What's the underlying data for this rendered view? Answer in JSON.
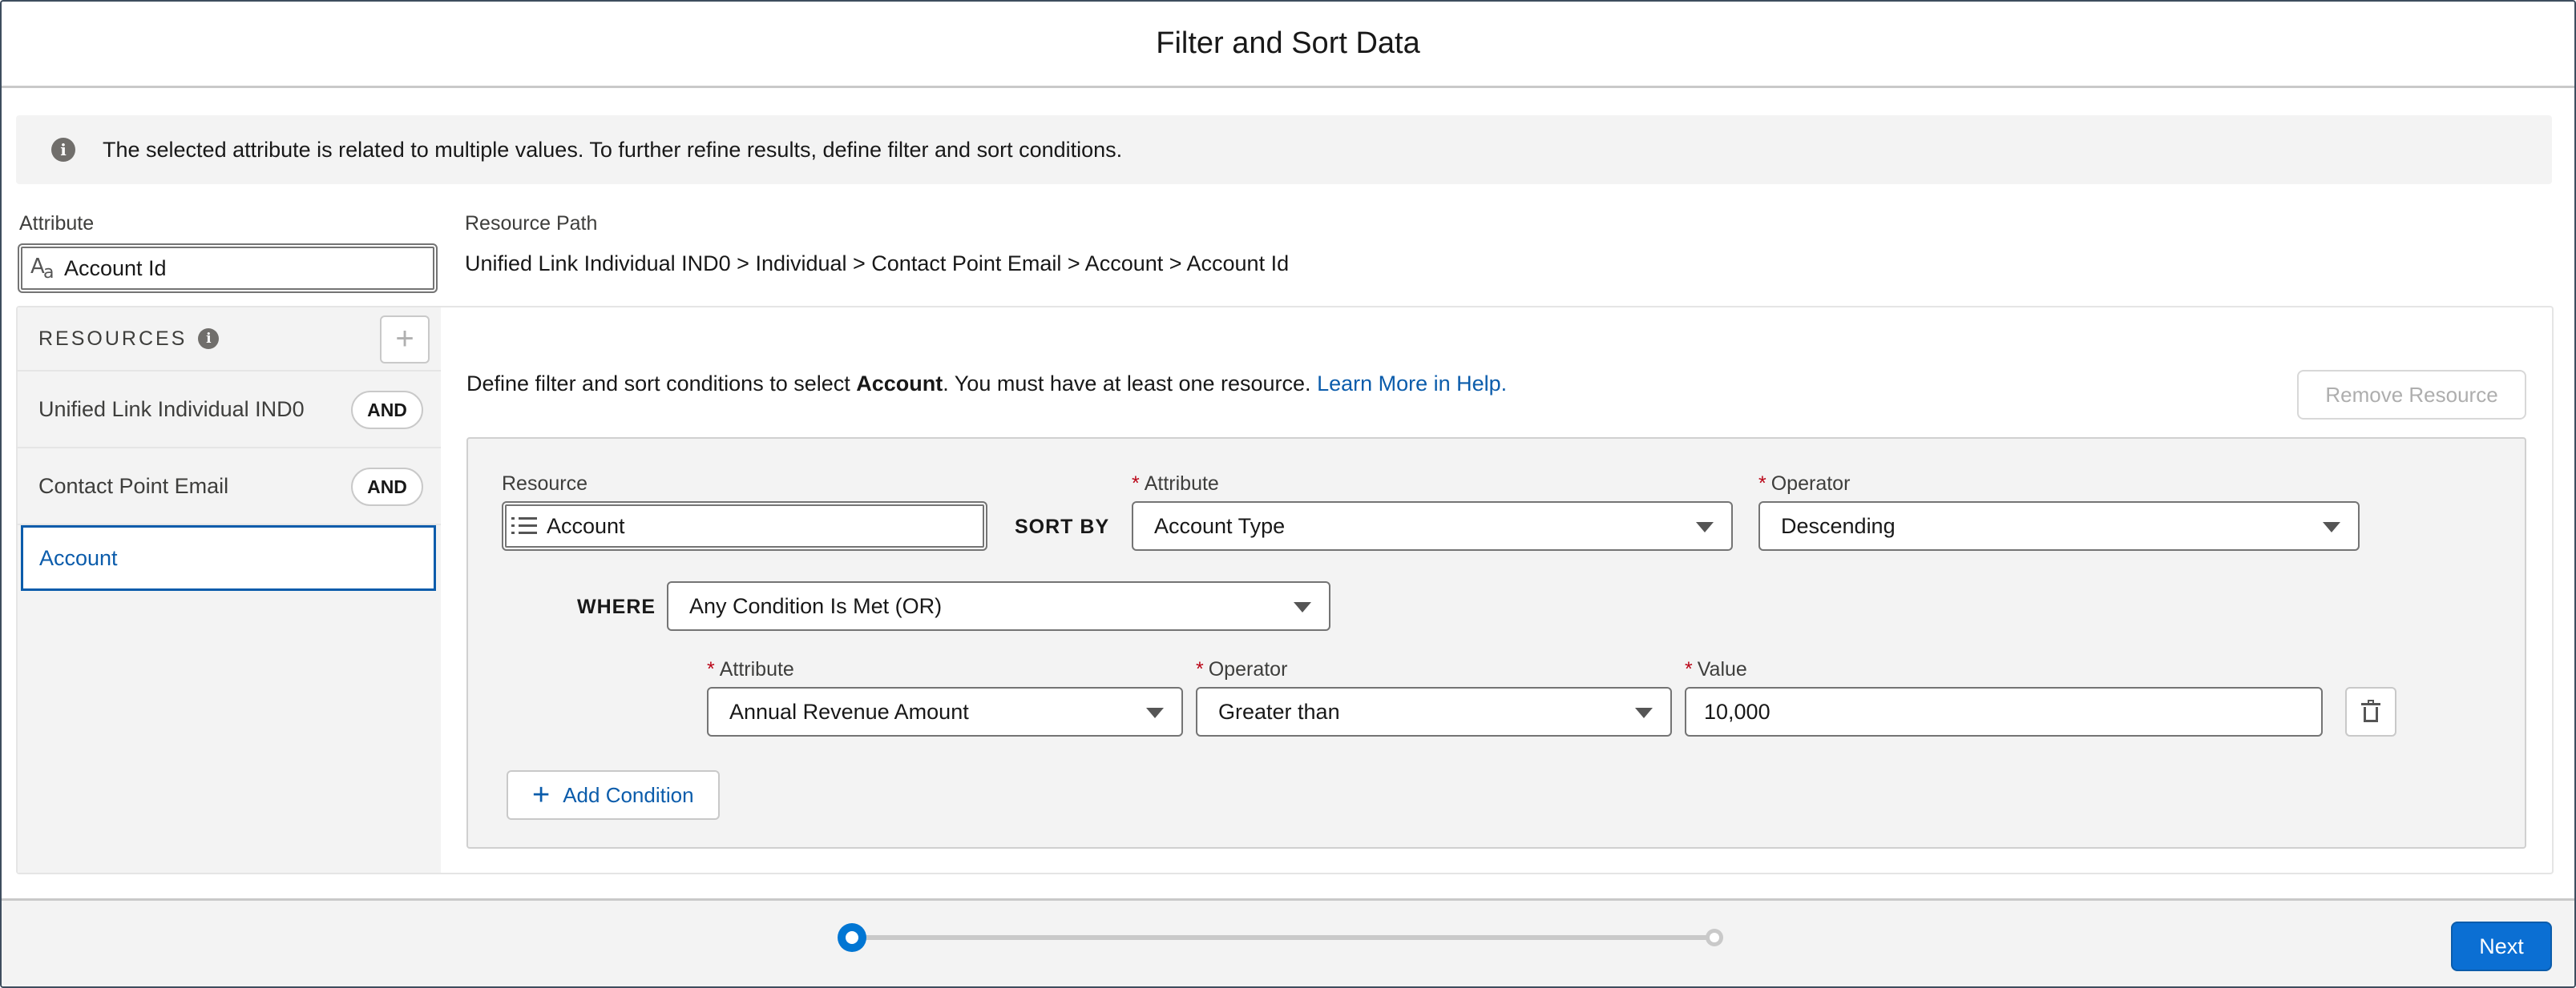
{
  "header": {
    "title": "Filter and Sort Data"
  },
  "banner": {
    "icon": "info-icon",
    "message": "The selected attribute is related to multiple values. To further refine results, define filter and sort conditions."
  },
  "attribute": {
    "label": "Attribute",
    "value": "Account Id",
    "icon": "text-type-icon"
  },
  "resource_path": {
    "label": "Resource Path",
    "value": "Unified Link Individual IND0 > Individual > Contact Point Email > Account > Account Id"
  },
  "sidebar": {
    "title": "RESOURCES",
    "add_symbol": "+",
    "items": [
      {
        "label": "Unified Link Individual IND0",
        "badge": "AND"
      },
      {
        "label": "Contact Point Email",
        "badge": "AND"
      },
      {
        "label": "Account",
        "active": true
      }
    ]
  },
  "main": {
    "intro_prefix": "Define filter and sort conditions to select ",
    "intro_bold": "Account",
    "intro_suffix": ". You must have at least one resource. ",
    "help_link": "Learn More in Help.",
    "remove_button": "Remove Resource"
  },
  "conditions": {
    "resource": {
      "label": "Resource",
      "value": "Account"
    },
    "sort_by": "SORT BY",
    "sort_attribute": {
      "label": "Attribute",
      "value": "Account Type"
    },
    "sort_operator": {
      "label": "Operator",
      "value": "Descending"
    },
    "where": "WHERE",
    "where_logic": "Any Condition Is Met (OR)",
    "rows": [
      {
        "attribute_label": "Attribute",
        "attribute": "Annual Revenue Amount",
        "operator_label": "Operator",
        "operator": "Greater than",
        "value_label": "Value",
        "value": "10,000"
      }
    ],
    "add_condition": "Add Condition",
    "required_marker": "*"
  },
  "footer": {
    "next": "Next",
    "progress": 0
  },
  "colors": {
    "brand": "#0b5cab",
    "button": "#0b6fd3",
    "required": "#ba0517"
  }
}
